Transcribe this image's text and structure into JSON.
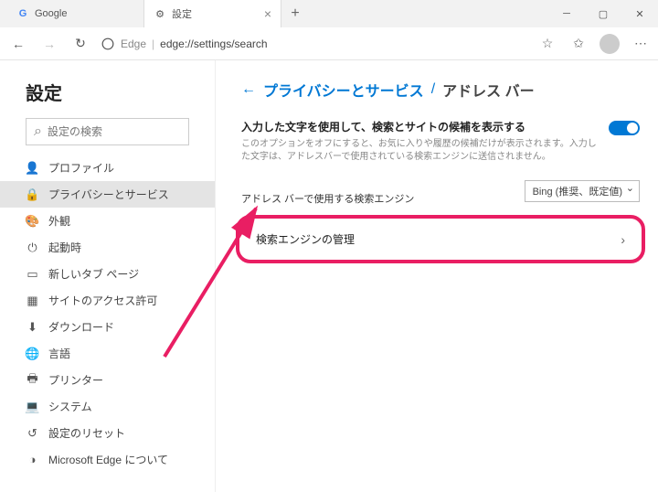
{
  "tabs": [
    {
      "title": "Google",
      "favicon": "G"
    },
    {
      "title": "設定",
      "favicon": "⚙"
    }
  ],
  "address": {
    "prefix": "Edge",
    "url": "edge://settings/search"
  },
  "sidebar": {
    "title": "設定",
    "search_placeholder": "設定の検索",
    "items": [
      {
        "icon": "person",
        "label": "プロファイル"
      },
      {
        "icon": "lock",
        "label": "プライバシーとサービス"
      },
      {
        "icon": "paint",
        "label": "外観"
      },
      {
        "icon": "power",
        "label": "起動時"
      },
      {
        "icon": "tab",
        "label": "新しいタブ ページ"
      },
      {
        "icon": "site",
        "label": "サイトのアクセス許可"
      },
      {
        "icon": "download",
        "label": "ダウンロード"
      },
      {
        "icon": "lang",
        "label": "言語"
      },
      {
        "icon": "printer",
        "label": "プリンター"
      },
      {
        "icon": "system",
        "label": "システム"
      },
      {
        "icon": "reset",
        "label": "設定のリセット"
      },
      {
        "icon": "edge",
        "label": "Microsoft Edge について"
      }
    ],
    "active_index": 1
  },
  "breadcrumb": {
    "link": "プライバシーとサービス",
    "current": "アドレス バー"
  },
  "setting1": {
    "title": "入力した文字を使用して、検索とサイトの候補を表示する",
    "desc": "このオプションをオフにすると、お気に入りや履歴の候補だけが表示されます。入力した文字は、アドレスバーで使用されている検索エンジンに送信されません。"
  },
  "engine": {
    "label": "アドレス バーで使用する検索エンジン",
    "selected": "Bing (推奨、既定値)"
  },
  "manage": {
    "label": "検索エンジンの管理"
  }
}
